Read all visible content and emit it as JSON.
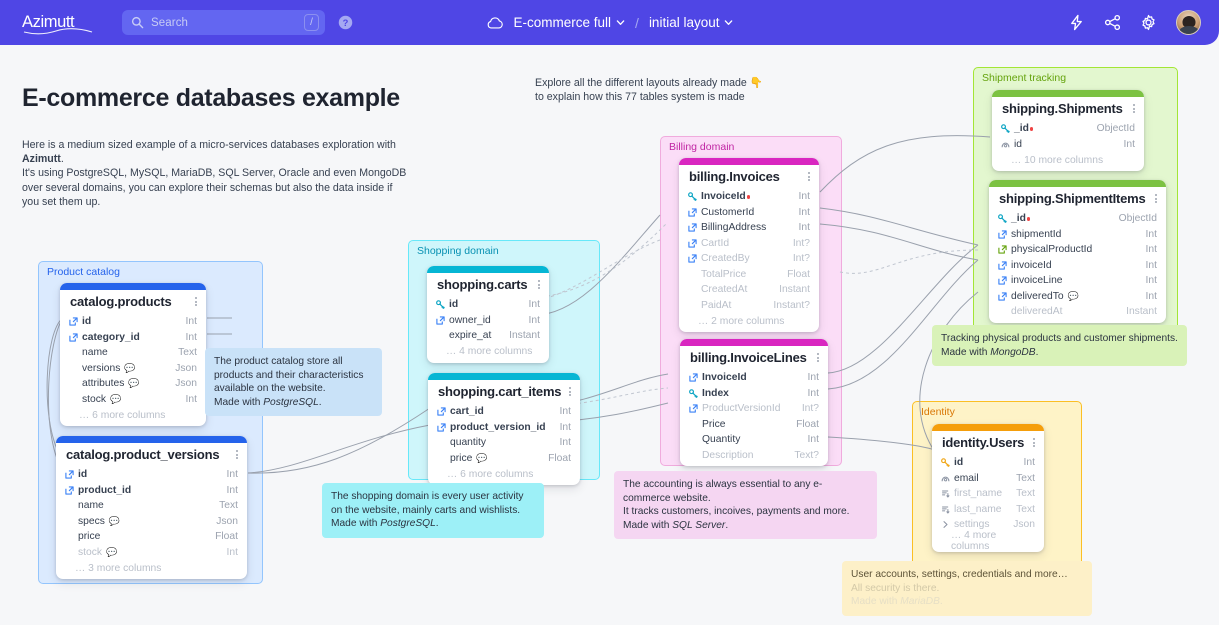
{
  "header": {
    "brand": "Azimutt",
    "search": {
      "placeholder": "Search",
      "shortcut": "/"
    },
    "help_icon": "help-icon",
    "cloud_icon": "cloud-icon",
    "project": "E-commerce full",
    "separator": "/",
    "layout": "initial layout",
    "actions": [
      "bolt-icon",
      "share-icon",
      "gear-icon",
      "avatar"
    ]
  },
  "page": {
    "title": "E-commerce databases example",
    "intro_line1": "Here is a medium sized example of a micro-services databases exploration with ",
    "intro_brand": "Azimutt",
    "intro_line1_end": ".",
    "intro_line2": "It's using PostgreSQL, MySQL, MariaDB, SQL Server, Oracle and even MongoDB over several domains, you can explore their schemas but also the data inside if you set them up.",
    "explore_line1": "Explore all the different layouts already made ",
    "explore_hand": "👇",
    "explore_line2": "to explain how this 77 tables system is made"
  },
  "groups": {
    "product": "Product catalog",
    "shopping": "Shopping domain",
    "billing": "Billing domain",
    "shipment": "Shipment tracking",
    "identity": "Identity"
  },
  "notes": {
    "product": {
      "l1": "The product catalog store all",
      "l2": "products and their characteristics",
      "l3": "available on the website.",
      "l4_pre": "Made with ",
      "l4_em": "PostgreSQL",
      "l4_post": "."
    },
    "shopping": {
      "l1": "The shopping domain is every user activity",
      "l2": "on the website, mainly carts and wishlists.",
      "l3_pre": "Made with ",
      "l3_em": "PostgreSQL",
      "l3_post": "."
    },
    "billing": {
      "l1": "The accounting is always essential to any e-",
      "l2": "commerce website.",
      "l3": "It tracks customers, incoives, payments and more.",
      "l4_pre": "Made with ",
      "l4_em": "SQL Server",
      "l4_post": "."
    },
    "shipment": {
      "l1": "Tracking physical products and customer shipments.",
      "l2_pre": "Made with ",
      "l2_em": "MongoDB",
      "l2_post": "."
    },
    "identity": {
      "l1": "User accounts, settings, credentials and more…",
      "l2": "All security is there.",
      "l3_pre": "Made with ",
      "l3_em": "MariaDB",
      "l3_post": "."
    }
  },
  "tables": [
    {
      "id": "catalog_products",
      "name": "catalog.products",
      "accent": "#2563eb",
      "columns": [
        {
          "name": "id",
          "type": "Int",
          "icon": "fk-icon",
          "bold": true,
          "muted": false,
          "note": false
        },
        {
          "name": "category_id",
          "type": "Int",
          "icon": "fk-icon",
          "bold": true,
          "muted": false,
          "note": false
        },
        {
          "name": "name",
          "type": "Text",
          "icon": "none",
          "bold": false,
          "muted": false,
          "note": false
        },
        {
          "name": "versions",
          "type": "Json",
          "icon": "none",
          "bold": false,
          "muted": false,
          "note": true
        },
        {
          "name": "attributes",
          "type": "Json",
          "icon": "none",
          "bold": false,
          "muted": false,
          "note": true
        },
        {
          "name": "stock",
          "type": "Int",
          "icon": "none",
          "bold": false,
          "muted": false,
          "note": true
        }
      ],
      "more": "… 6 more columns"
    },
    {
      "id": "catalog_product_versions",
      "name": "catalog.product_versions",
      "accent": "#2563eb",
      "columns": [
        {
          "name": "id",
          "type": "Int",
          "icon": "fk-icon",
          "bold": true,
          "muted": false,
          "note": false
        },
        {
          "name": "product_id",
          "type": "Int",
          "icon": "fk-icon",
          "bold": true,
          "muted": false,
          "note": false
        },
        {
          "name": "name",
          "type": "Text",
          "icon": "none",
          "bold": false,
          "muted": false,
          "note": false
        },
        {
          "name": "specs",
          "type": "Json",
          "icon": "none",
          "bold": false,
          "muted": false,
          "note": true
        },
        {
          "name": "price",
          "type": "Float",
          "icon": "none",
          "bold": false,
          "muted": false,
          "note": false
        },
        {
          "name": "stock",
          "type": "Int",
          "icon": "none",
          "bold": false,
          "muted": true,
          "note": true
        }
      ],
      "more": "… 3 more columns"
    },
    {
      "id": "shopping_carts",
      "name": "shopping.carts",
      "accent": "#06b6d4",
      "columns": [
        {
          "name": "id",
          "type": "Int",
          "icon": "pk-icon",
          "bold": true,
          "muted": false,
          "note": false
        },
        {
          "name": "owner_id",
          "type": "Int",
          "icon": "fk-icon",
          "bold": false,
          "muted": false,
          "note": false
        },
        {
          "name": "expire_at",
          "type": "Instant",
          "icon": "none",
          "bold": false,
          "muted": false,
          "note": false
        }
      ],
      "more": "… 4 more columns"
    },
    {
      "id": "shopping_cart_items",
      "name": "shopping.cart_items",
      "accent": "#06b6d4",
      "columns": [
        {
          "name": "cart_id",
          "type": "Int",
          "icon": "fk-icon",
          "bold": true,
          "muted": false,
          "note": false
        },
        {
          "name": "product_version_id",
          "type": "Int",
          "icon": "fk-icon",
          "bold": true,
          "muted": false,
          "note": false
        },
        {
          "name": "quantity",
          "type": "Int",
          "icon": "none",
          "bold": false,
          "muted": false,
          "note": false
        },
        {
          "name": "price",
          "type": "Float",
          "icon": "none",
          "bold": false,
          "muted": false,
          "note": true
        }
      ],
      "more": "… 6 more columns"
    },
    {
      "id": "billing_invoices",
      "name": "billing.Invoices",
      "accent": "#d926c0",
      "columns": [
        {
          "name": "InvoiceId",
          "type": "Int",
          "icon": "pk-icon",
          "bold": true,
          "muted": false,
          "note": false,
          "flag": true
        },
        {
          "name": "CustomerId",
          "type": "Int",
          "icon": "fk-icon",
          "bold": false,
          "muted": false,
          "note": false
        },
        {
          "name": "BillingAddress",
          "type": "Int",
          "icon": "fk-icon",
          "bold": false,
          "muted": false,
          "note": false
        },
        {
          "name": "CartId",
          "type": "Int?",
          "icon": "fk-icon",
          "bold": false,
          "muted": true,
          "note": false
        },
        {
          "name": "CreatedBy",
          "type": "Int?",
          "icon": "fk-icon",
          "bold": false,
          "muted": true,
          "note": false
        },
        {
          "name": "TotalPrice",
          "type": "Float",
          "icon": "none",
          "bold": false,
          "muted": true,
          "note": false
        },
        {
          "name": "CreatedAt",
          "type": "Instant",
          "icon": "none",
          "bold": false,
          "muted": true,
          "note": false
        },
        {
          "name": "PaidAt",
          "type": "Instant?",
          "icon": "none",
          "bold": false,
          "muted": true,
          "note": false
        }
      ],
      "more": "… 2 more columns"
    },
    {
      "id": "billing_invoicelines",
      "name": "billing.InvoiceLines",
      "accent": "#d926c0",
      "columns": [
        {
          "name": "InvoiceId",
          "type": "Int",
          "icon": "fk-icon",
          "bold": true,
          "muted": false,
          "note": false
        },
        {
          "name": "Index",
          "type": "Int",
          "icon": "pk-icon",
          "bold": true,
          "muted": false,
          "note": false
        },
        {
          "name": "ProductVersionId",
          "type": "Int?",
          "icon": "fk-icon",
          "bold": false,
          "muted": true,
          "note": false
        },
        {
          "name": "Price",
          "type": "Float",
          "icon": "none",
          "bold": false,
          "muted": false,
          "note": false
        },
        {
          "name": "Quantity",
          "type": "Int",
          "icon": "none",
          "bold": false,
          "muted": false,
          "note": false
        },
        {
          "name": "Description",
          "type": "Text?",
          "icon": "none",
          "bold": false,
          "muted": true,
          "note": false
        }
      ],
      "more": ""
    },
    {
      "id": "shipping_shipments",
      "name": "shipping.Shipments",
      "accent": "#7cc242",
      "columns": [
        {
          "name": "_id",
          "type": "ObjectId",
          "icon": "pk-icon",
          "bold": true,
          "muted": false,
          "note": false,
          "flag": true
        },
        {
          "name": "id",
          "type": "Int",
          "icon": "index-icon",
          "bold": false,
          "muted": false,
          "note": false
        }
      ],
      "more": "… 10 more columns"
    },
    {
      "id": "shipping_shipmentitems",
      "name": "shipping.ShipmentItems",
      "accent": "#7cc242",
      "columns": [
        {
          "name": "_id",
          "type": "ObjectId",
          "icon": "pk-icon",
          "bold": true,
          "muted": false,
          "note": false,
          "flag": true
        },
        {
          "name": "shipmentId",
          "type": "Int",
          "icon": "fk-icon",
          "bold": false,
          "muted": false,
          "note": false
        },
        {
          "name": "physicalProductId",
          "type": "Int",
          "icon": "fk-green-icon",
          "bold": false,
          "muted": false,
          "note": false
        },
        {
          "name": "invoiceId",
          "type": "Int",
          "icon": "fk-icon",
          "bold": false,
          "muted": false,
          "note": false
        },
        {
          "name": "invoiceLine",
          "type": "Int",
          "icon": "fk-icon",
          "bold": false,
          "muted": false,
          "note": false
        },
        {
          "name": "deliveredTo",
          "type": "Int",
          "icon": "fk-icon",
          "bold": false,
          "muted": false,
          "note": true
        },
        {
          "name": "deliveredAt",
          "type": "Instant",
          "icon": "none",
          "bold": false,
          "muted": true,
          "note": false
        }
      ],
      "more": ""
    },
    {
      "id": "identity_users",
      "name": "identity.Users",
      "accent": "#f59e0b",
      "columns": [
        {
          "name": "id",
          "type": "Int",
          "icon": "pk-gold-icon",
          "bold": true,
          "muted": false,
          "note": false
        },
        {
          "name": "email",
          "type": "Text",
          "icon": "index-icon",
          "bold": false,
          "muted": false,
          "note": false
        },
        {
          "name": "first_name",
          "type": "Text",
          "icon": "sort-icon",
          "bold": false,
          "muted": true,
          "note": false
        },
        {
          "name": "last_name",
          "type": "Text",
          "icon": "sort-icon",
          "bold": false,
          "muted": true,
          "note": false
        },
        {
          "name": "settings",
          "type": "Json",
          "icon": "nested-icon",
          "bold": false,
          "muted": true,
          "note": false
        }
      ],
      "more": "… 4 more columns"
    }
  ]
}
